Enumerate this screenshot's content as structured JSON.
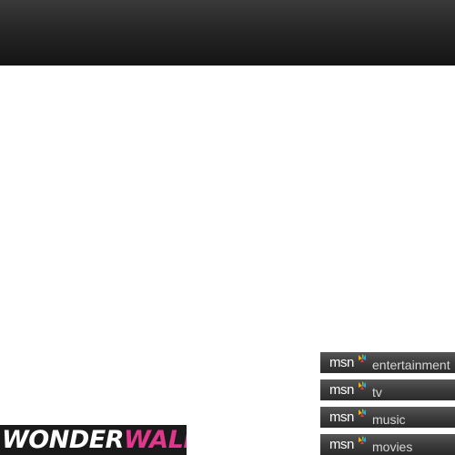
{
  "brand": {
    "logo_part1": "WONDER",
    "logo_part2": "WALL",
    "logo_colors": {
      "part1": "#ffffff",
      "part2": "#e0368c",
      "background": "#1a1a1a"
    }
  },
  "msn_links": [
    {
      "brand": "msn",
      "label": "entertainment"
    },
    {
      "brand": "msn",
      "label": "tv"
    },
    {
      "brand": "msn",
      "label": "music"
    },
    {
      "brand": "msn",
      "label": "movies"
    }
  ],
  "icons": {
    "msn_logo": "msn-butterfly-icon"
  }
}
